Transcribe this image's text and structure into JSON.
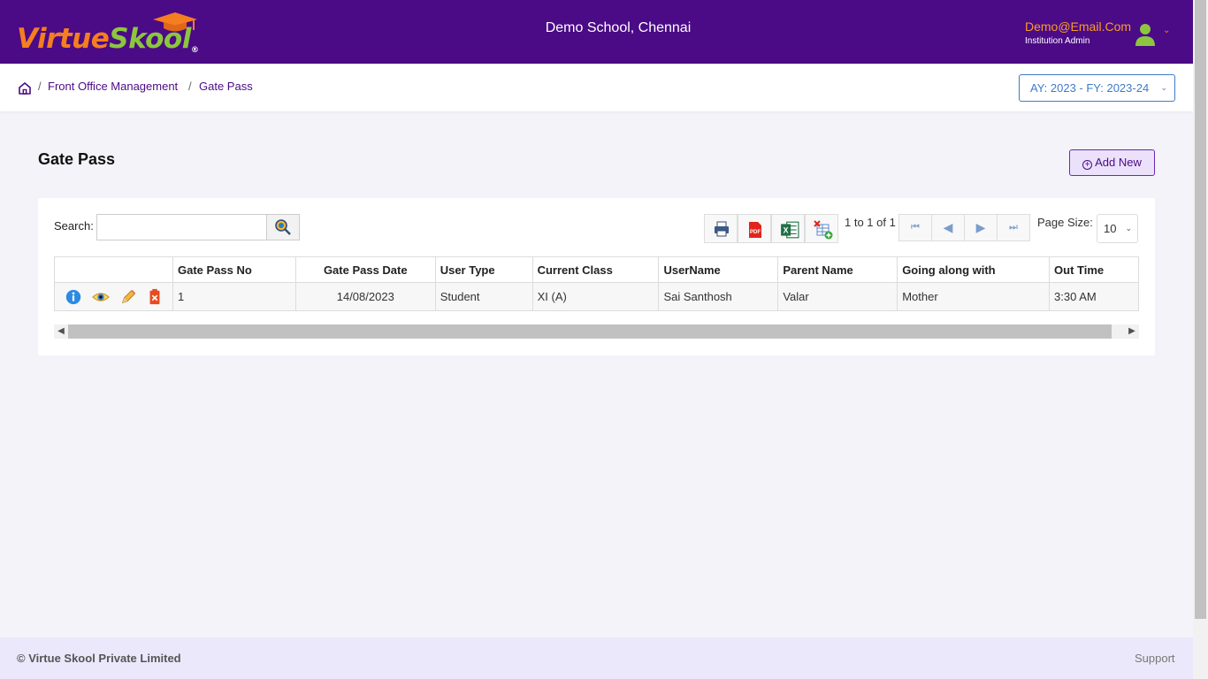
{
  "header": {
    "logo_part1": "Virtue",
    "logo_part2": "Skool",
    "logo_mark": "®",
    "school": "Demo School, Chennai",
    "user_email": "Demo@Email.Com",
    "user_role": "Institution Admin",
    "colors": {
      "background": "#4b0a86",
      "brand_orange": "#f57e20",
      "brand_green": "#8cc63f"
    }
  },
  "breadcrumb": {
    "items": [
      "Front Office Management",
      "Gate Pass"
    ],
    "separator": "/",
    "home_icon": "home-icon"
  },
  "year_selector": {
    "value": "AY: 2023 - FY: 2023-24"
  },
  "page": {
    "title": "Gate Pass",
    "add_button": "Add New"
  },
  "toolbar": {
    "search_label": "Search:",
    "search_value": "",
    "search_icon": "search-icon",
    "export_icons": [
      "print-icon",
      "pdf-icon",
      "excel-icon",
      "column-chooser-icon"
    ],
    "paging_text": "1 to 1 of 1",
    "page_size_label": "Page Size:",
    "page_size": "10"
  },
  "grid": {
    "columns": [
      "",
      "Gate Pass No",
      "Gate Pass Date",
      "User Type",
      "Current Class",
      "UserName",
      "Parent Name",
      "Going along with",
      "Out Time"
    ],
    "rows": [
      {
        "actions": [
          "info-icon",
          "view-icon",
          "edit-icon",
          "delete-icon"
        ],
        "gate_pass_no": "1",
        "gate_pass_date": "14/08/2023",
        "user_type": "Student",
        "current_class": "XI (A)",
        "username": "Sai Santhosh",
        "parent_name": "Valar",
        "going_along_with": "Mother",
        "out_time": "3:30 AM"
      }
    ]
  },
  "footer": {
    "copyright": "© Virtue Skool Private Limited",
    "support": "Support"
  }
}
